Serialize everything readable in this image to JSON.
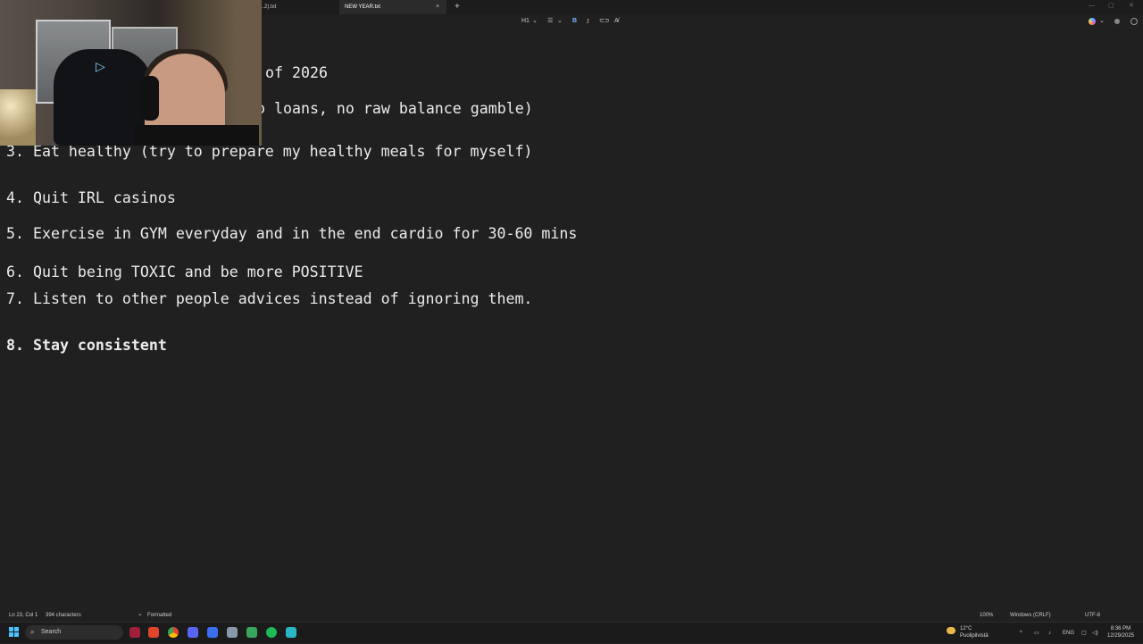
{
  "tabs": [
    {
      "label": "…2).txt"
    },
    {
      "label": "NEW YEAR.txt",
      "active": true
    }
  ],
  "tab_close_glyph": "×",
  "tab_add_glyph": "+",
  "window_controls": [
    "—",
    "▢",
    "✕"
  ],
  "toolbar": {
    "heading": "H1",
    "heading_chevron": "⌄",
    "list_glyph": "☰",
    "list_chevron": "⌄",
    "bold": "B",
    "italic": "I",
    "link_glyph": "⊂⊃",
    "clear_glyph": "A̸",
    "copilot_chevron": "⌄"
  },
  "document": {
    "lines": [
      {
        "text": "of 2026",
        "bold": false
      },
      {
        "text": "o loans, no raw balance gamble)",
        "bold": false
      },
      {
        "text": "3. Eat healthy (try to prepare my healthy meals for myself)",
        "bold": false
      },
      {
        "text": "4. Quit IRL casinos",
        "bold": false
      },
      {
        "text": "5. Exercise in GYM everyday and in the end cardio for 30-60 mins",
        "bold": false
      },
      {
        "text": "6. Quit being TOXIC and be more POSITIVE",
        "bold": false
      },
      {
        "text": "7. Listen to other people advices instead of ignoring them.",
        "bold": false
      },
      {
        "text": "8. Stay consistent",
        "bold": true
      }
    ]
  },
  "statusbar": {
    "position": "Ln 23, Col 1",
    "characters": "394 characters",
    "format": "Formatted",
    "zoom": "100%",
    "line_ending": "Windows (CRLF)",
    "encoding": "UTF-8"
  },
  "taskbar": {
    "search_label": "Search",
    "weather_temp": "12°C",
    "weather_desc": "Puolipilvistä",
    "language": "ENG",
    "time": "8:36 PM",
    "date": "12/29/2025"
  },
  "colors": {
    "background": "#202020",
    "text": "#ececec",
    "accent": "#4cc2ff",
    "bold_button": "#7ab7ff"
  }
}
